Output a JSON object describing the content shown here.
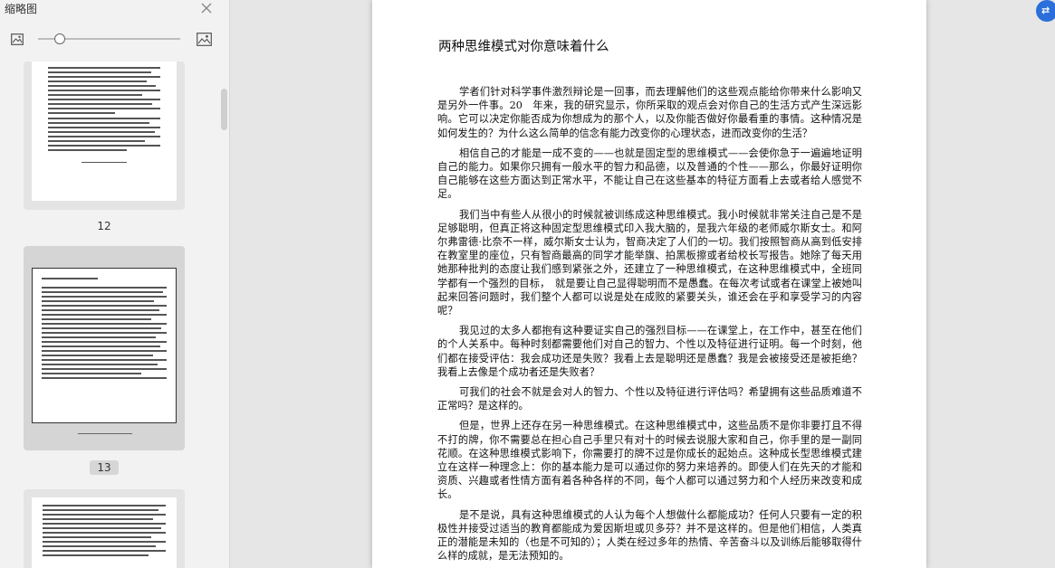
{
  "sidebar": {
    "title": "缩略图",
    "pages": [
      {
        "number": "12"
      },
      {
        "number": "13",
        "active": true
      },
      {
        "number": ""
      }
    ]
  },
  "icons": {
    "close": "close-icon",
    "small_image": "image-small-icon",
    "large_image": "image-large-icon"
  },
  "zoom": {
    "level": 0.15
  },
  "colors": {
    "accent": "#2a6fdb"
  },
  "document": {
    "title": "两种思维模式对你意味着什么",
    "paragraphs": [
      "学者们针对科学事件激烈辩论是一回事，而去理解他们的这些观点能给你带来什么影响又是另外一件事。20　年来，我的研究显示，你所采取的观点会对你自己的生活方式产生深远影响。它可以决定你能否成为你想成为的那个人，以及你能否做好你最看重的事情。这种情况是如何发生的？为什么这么简单的信念有能力改变你的心理状态，进而改变你的生活？",
      "相信自己的才能是一成不变的——也就是固定型的思维模式——会使你急于一遍遍地证明自己的能力。如果你只拥有一般水平的智力和品德，以及普通的个性——那么，你最好证明你自己能够在这些方面达到正常水平，不能让自己在这些基本的特征方面看上去或者给人感觉不足。",
      "我们当中有些人从很小的时候就被训练成这种思维模式。我小时候就非常关注自己是不是足够聪明，但真正将这种固定型思维模式印入我大脑的，是我六年级的老师威尔斯女士。和阿尔弗雷德·比奈不一样，威尔斯女士认为，智商决定了人们的一切。我们按照智商从高到低安排在教室里的座位，只有智商最高的同学才能举旗、拍黑板擦或者给校长写报告。她除了每天用她那种批判的态度让我们感到紧张之外，还建立了一种思维模式，在这种思维模式中，全班同学都有一个强烈的目标，　就是要让自己显得聪明而不是愚蠢。在每次考试或者在课堂上被她叫起来回答问题时，我们整个人都可以说是处在成败的紧要关头，谁还会在乎和享受学习的内容呢？",
      "我见过的太多人都抱有这种要证实自己的强烈目标——在课堂上，在工作中，甚至在他们的个人关系中。每种时刻都需要他们对自己的智力、个性以及特征进行证明。每一个时刻，他们都在接受评估：我会成功还是失败？我看上去是聪明还是愚蠢？我是会被接受还是被拒绝？我看上去像是个成功者还是失败者？",
      "可我们的社会不就是会对人的智力、个性以及特征进行评估吗？希望拥有这些品质难道不正常吗？是这样的。",
      "但是，世界上还存在另一种思维模式。在这种思维模式中，这些品质不是你非要打且不得不打的牌，你不需要总在担心自己手里只有对十的时候去说服大家和自己，你手里的是一副同花顺。在这种思维模式影响下，你需要打的牌不过是你成长的起始点。这种成长型思维模式建立在这样一种理念上：你的基本能力是可以通过你的努力来培养的。即使人们在先天的才能和资质、兴趣或者性情方面有着各种各样的不同，每个人都可以通过努力和个人经历来改变和成长。",
      "是不是说，具有这种思维模式的人认为每个人想做什么都能成功？任何人只要有一定的积极性并接受过适当的教育都能成为爱因斯坦或贝多芬？并不是这样的。但是他们相信，人类真正的潜能是未知的（也是不可知的）；人类在经过多年的热情、辛苦奋斗以及训练后能够取得什么样的成就，是无法预知的。"
    ]
  }
}
